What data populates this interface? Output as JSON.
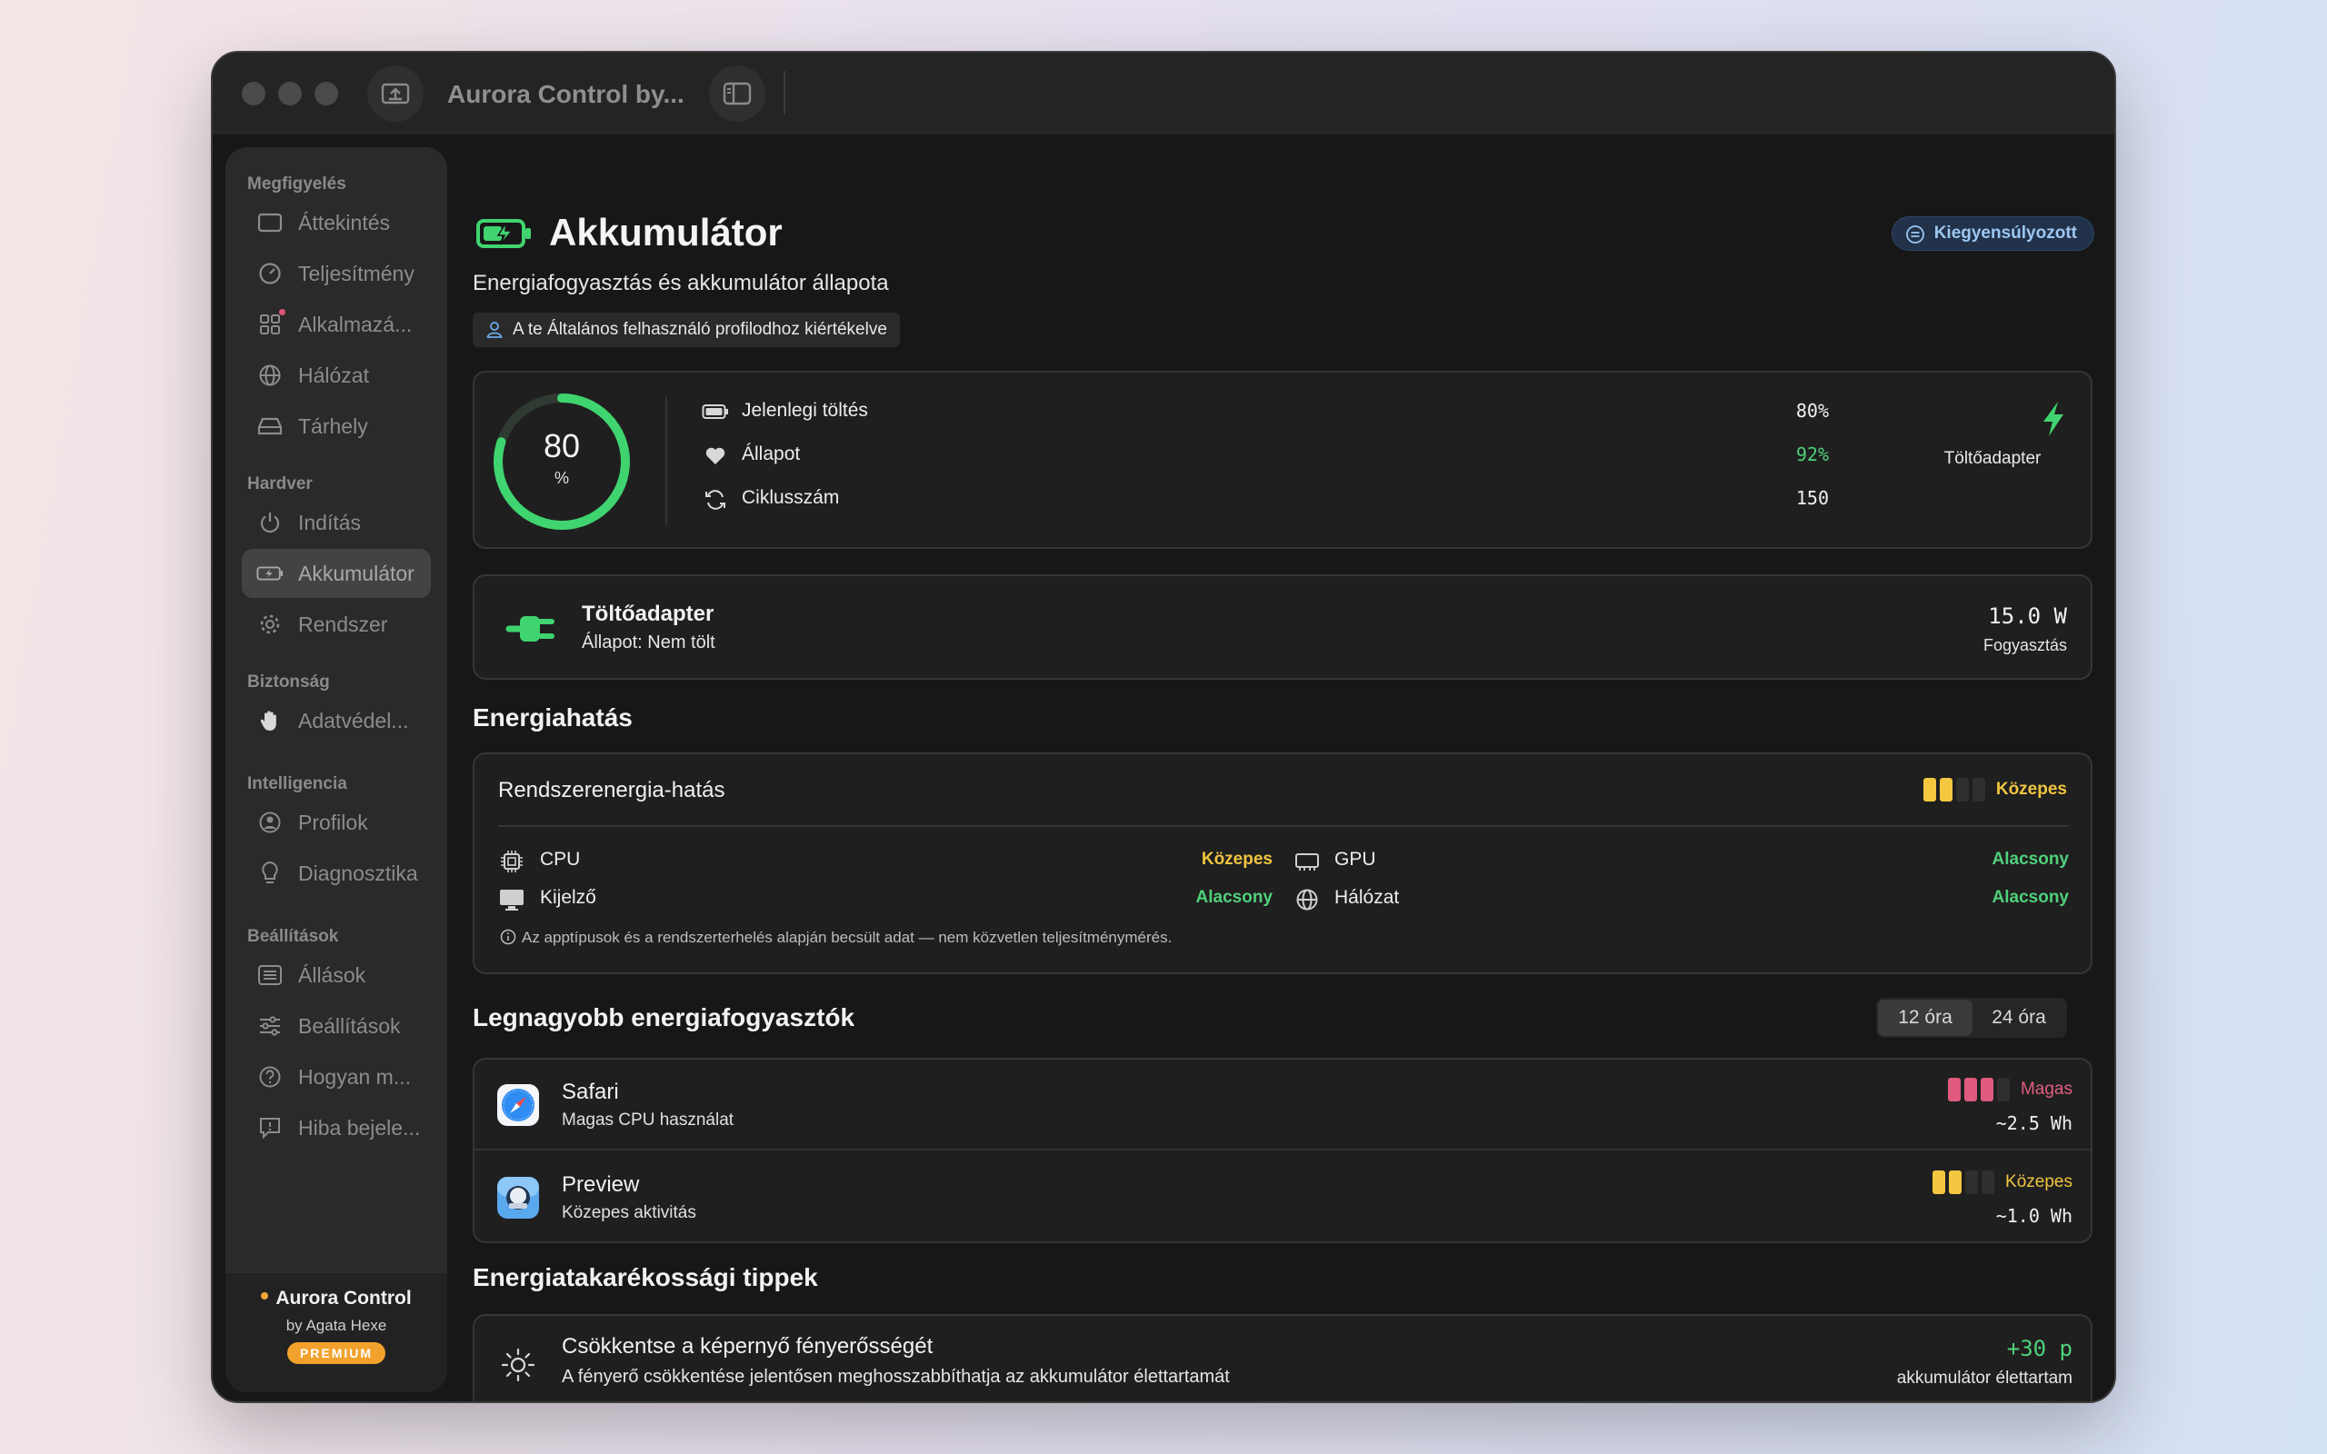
{
  "window": {
    "title": "Aurora Control by..."
  },
  "sidebar": {
    "sections": [
      {
        "label": "Megfigyelés",
        "items": [
          {
            "label": "Áttekintés",
            "icon": "overview-icon"
          },
          {
            "label": "Teljesítmény",
            "icon": "gauge-icon"
          },
          {
            "label": "Alkalmazá...",
            "icon": "apps-grid-icon",
            "badge": true
          },
          {
            "label": "Hálózat",
            "icon": "globe-icon"
          },
          {
            "label": "Tárhely",
            "icon": "drive-icon"
          }
        ]
      },
      {
        "label": "Hardver",
        "items": [
          {
            "label": "Indítás",
            "icon": "power-icon"
          },
          {
            "label": "Akkumulátor",
            "icon": "battery-icon",
            "active": true
          },
          {
            "label": "Rendszer",
            "icon": "gear-icon"
          }
        ]
      },
      {
        "label": "Biztonság",
        "items": [
          {
            "label": "Adatvédel...",
            "icon": "hand-icon"
          }
        ]
      },
      {
        "label": "Intelligencia",
        "items": [
          {
            "label": "Profilok",
            "icon": "person-circle-icon"
          },
          {
            "label": "Diagnosztika",
            "icon": "lightbulb-icon"
          }
        ]
      },
      {
        "label": "Beállítások",
        "items": [
          {
            "label": "Állások",
            "icon": "list-icon"
          },
          {
            "label": "Beállítások",
            "icon": "sliders-icon"
          },
          {
            "label": "Hogyan m...",
            "icon": "question-icon"
          },
          {
            "label": "Hiba bejele...",
            "icon": "report-icon"
          }
        ]
      }
    ],
    "footer": {
      "app": "Aurora Control",
      "by": "by Agata Hexe",
      "badge": "PREMIUM"
    }
  },
  "header": {
    "title": "Akkumulátor",
    "subtitle": "Energiafogyasztás és akkumulátor állapota",
    "profile_note": "A te Általános felhasználó profilodhoz kiértékelve",
    "mode_badge": "Kiegyensúlyozott"
  },
  "battery": {
    "percent": 80,
    "unit": "%",
    "rows": [
      {
        "label": "Jelenlegi töltés",
        "value": "80%",
        "icon": "battery-small-icon",
        "color": "#f0f0f0"
      },
      {
        "label": "Állapot",
        "value": "92%",
        "icon": "heart-icon",
        "color": "#4fd07a"
      },
      {
        "label": "Ciklusszám",
        "value": "150",
        "icon": "cycle-icon",
        "color": "#f0f0f0"
      }
    ],
    "source_label": "Töltőadapter",
    "ring_color": "#3fd46f"
  },
  "adapter": {
    "title": "Töltőadapter",
    "status": "Állapot: Nem tölt",
    "power": "15.0 W",
    "power_label": "Fogyasztás"
  },
  "impact": {
    "section_title": "Energiahatás",
    "card_title": "Rendszerenergia-hatás",
    "level": "Közepes",
    "level_bars": 2,
    "items": [
      {
        "label": "CPU",
        "value": "Közepes",
        "icon": "cpu-icon",
        "tone": "yellow"
      },
      {
        "label": "GPU",
        "value": "Alacsony",
        "icon": "gpu-icon",
        "tone": "green"
      },
      {
        "label": "Kijelző",
        "value": "Alacsony",
        "icon": "display-icon",
        "tone": "green"
      },
      {
        "label": "Hálózat",
        "value": "Alacsony",
        "icon": "globe-icon",
        "tone": "green"
      }
    ],
    "note": "Az apptípusok és a rendszerterhelés alapján becsült adat — nem közvetlen teljesítménymérés."
  },
  "consumers": {
    "section_title": "Legnagyobb energiafogyasztók",
    "tabs": [
      {
        "label": "12 óra",
        "active": true
      },
      {
        "label": "24 óra",
        "active": false
      }
    ],
    "apps": [
      {
        "name": "Safari",
        "desc": "Magas CPU használat",
        "level": "Magas",
        "bars": 3,
        "tone": "red",
        "energy": "~2.5 Wh",
        "icon": "safari-icon"
      },
      {
        "name": "Preview",
        "desc": "Közepes aktivitás",
        "level": "Közepes",
        "bars": 2,
        "tone": "yellow",
        "energy": "~1.0 Wh",
        "icon": "preview-icon"
      }
    ]
  },
  "tips": {
    "section_title": "Energiatakarékossági tippek",
    "items": [
      {
        "title": "Csökkentse a képernyő fényerősségét",
        "desc": "A fényerő csökkentése jelentősen meghosszabbíthatja az akkumulátor élettartamát",
        "gain": "+30 p",
        "gain_label": "akkumulátor élettartam",
        "icon": "sun-icon"
      }
    ]
  }
}
